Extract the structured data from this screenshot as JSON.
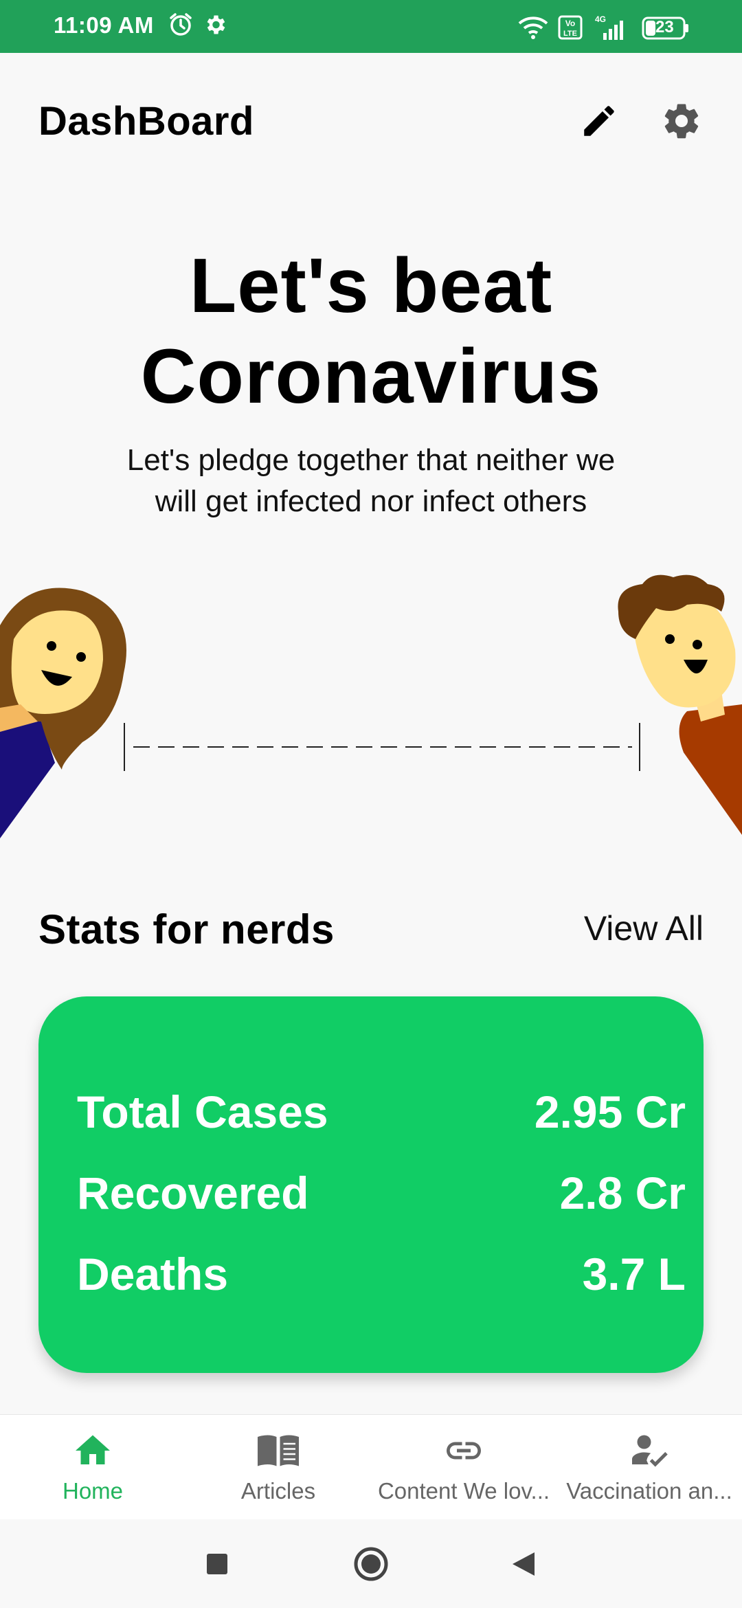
{
  "status_bar": {
    "time": "11:09 AM",
    "battery": "23",
    "network": "4G",
    "volte": "Vo LTE"
  },
  "header": {
    "title": "DashBoard"
  },
  "hero": {
    "title_line1": "Let's beat",
    "title_line2": "Coronavirus",
    "subtitle": "Let's pledge together that neither we will get infected nor infect others"
  },
  "stats": {
    "title": "Stats for nerds",
    "view_all": "View All",
    "rows": [
      {
        "label": "Total Cases",
        "value": "2.95 Cr"
      },
      {
        "label": "Recovered",
        "value": "2.8 Cr"
      },
      {
        "label": "Deaths",
        "value": "3.7 L"
      }
    ]
  },
  "bottom_nav": {
    "items": [
      {
        "label": "Home",
        "icon": "home-icon",
        "active": true
      },
      {
        "label": "Articles",
        "icon": "book-icon",
        "active": false
      },
      {
        "label": "Content We lov...",
        "icon": "link-icon",
        "active": false
      },
      {
        "label": "Vaccination an...",
        "icon": "person-check-icon",
        "active": false
      }
    ]
  },
  "colors": {
    "status_bar": "#21a159",
    "card": "#11cd65",
    "nav_active": "#21b35c",
    "nav_inactive": "#666666"
  }
}
